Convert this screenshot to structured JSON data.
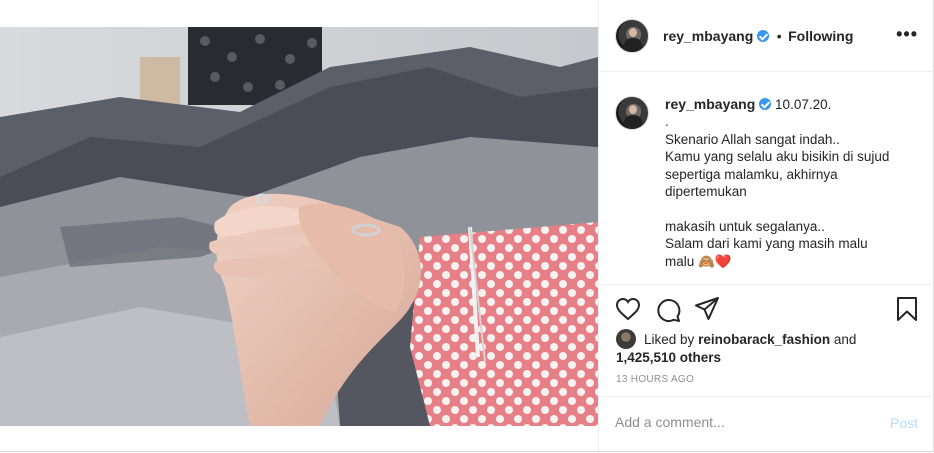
{
  "header": {
    "username": "rey_mbayang",
    "separator": "•",
    "follow_status": "Following",
    "more_label": "•••"
  },
  "caption": {
    "username": "rey_mbayang",
    "lines": [
      "10.07.20.",
      ".",
      "Skenario Allah sangat indah..",
      "Kamu yang selalu aku bisikin di sujud",
      "sepertiga malamku, akhirnya",
      "dipertemukan",
      "",
      "makasih untuk segalanya..",
      "Salam dari kami yang masih malu",
      "malu 🙈❤️"
    ]
  },
  "actions": {
    "icons": [
      "heart-icon",
      "comment-icon",
      "share-icon",
      "bookmark-icon"
    ]
  },
  "likes": {
    "prefix": "Liked by",
    "user": "reinobarack_fashion",
    "conjunction": "and",
    "count_text": "1,425,510 others"
  },
  "timestamp": "13 HOURS AGO",
  "comment": {
    "placeholder": "Add a comment...",
    "post_label": "Post"
  },
  "colors": {
    "verified": "#3897f0",
    "post_disabled": "#b2dffc",
    "sleeve": "#e87f86"
  }
}
